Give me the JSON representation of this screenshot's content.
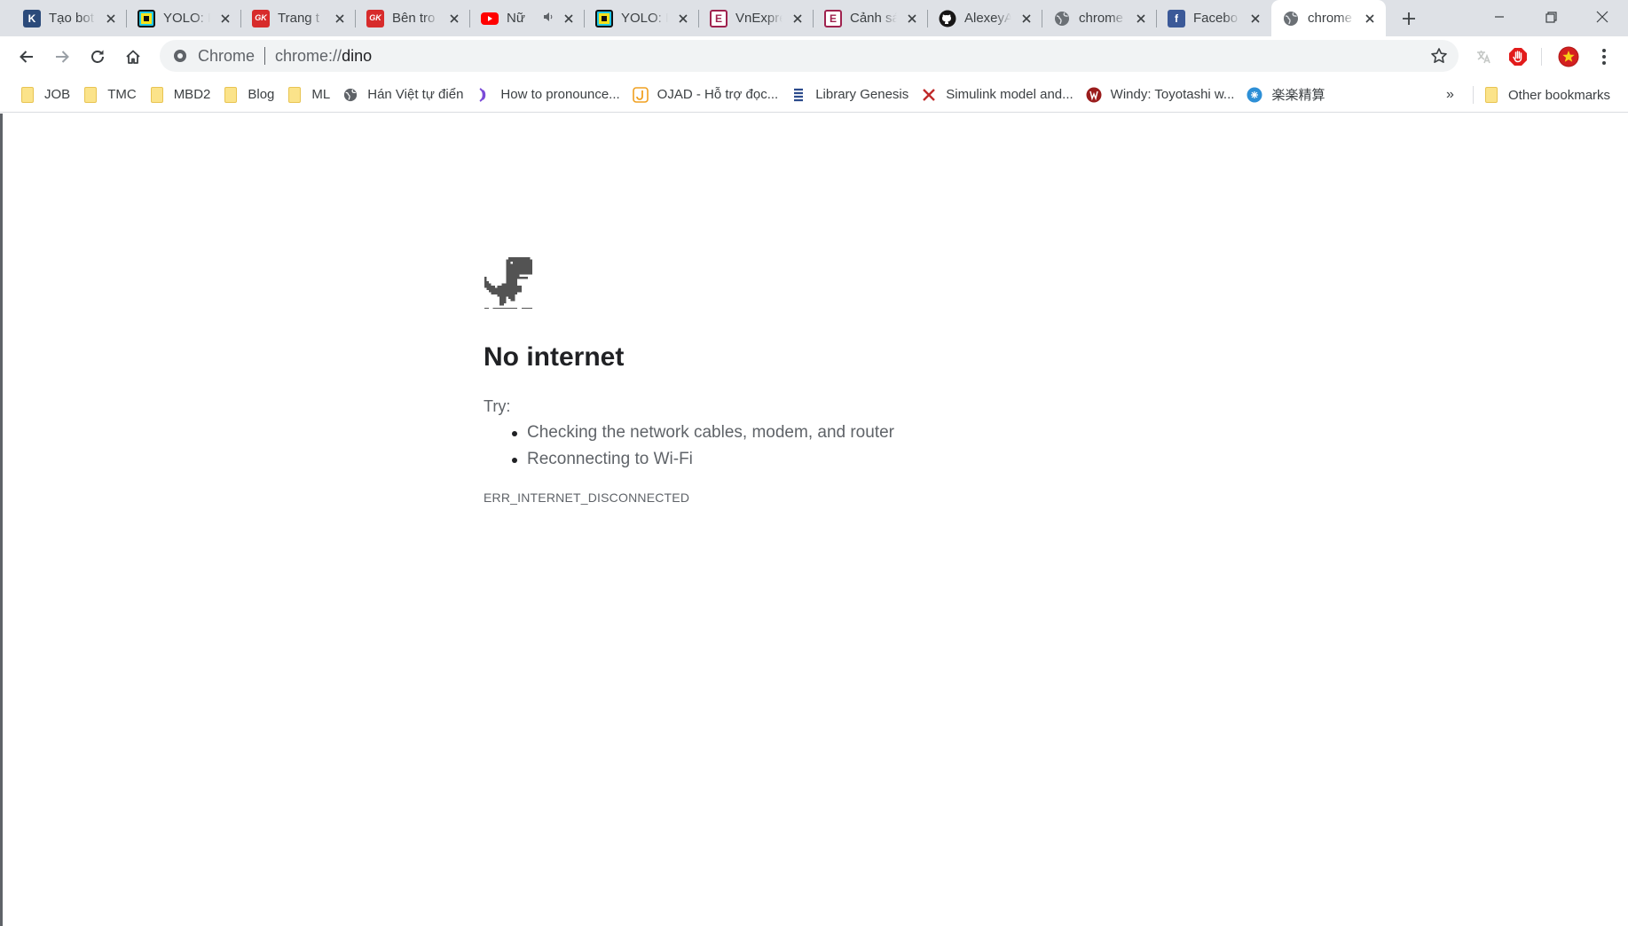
{
  "tabs": [
    {
      "favicon": "k-icon",
      "fav_text": "K",
      "title": "Tạo bot",
      "active": false
    },
    {
      "favicon": "yolo-icon",
      "fav_text": "",
      "title": "YOLO: F",
      "active": false
    },
    {
      "favicon": "news-red-icon",
      "fav_text": "GK",
      "title": "Trang t",
      "active": false
    },
    {
      "favicon": "news-red-icon",
      "fav_text": "GK",
      "title": "Bên tro",
      "active": false
    },
    {
      "favicon": "youtube-icon",
      "fav_text": "",
      "title": "Nữ",
      "active": false,
      "audio": true
    },
    {
      "favicon": "yolo-icon",
      "fav_text": "",
      "title": "YOLO: F",
      "active": false
    },
    {
      "favicon": "vnexpress-icon",
      "fav_text": "E",
      "title": "VnExpre",
      "active": false
    },
    {
      "favicon": "vnexpress-icon",
      "fav_text": "E",
      "title": "Cảnh sá",
      "active": false
    },
    {
      "favicon": "github-icon",
      "fav_text": "",
      "title": "AlexeyA",
      "active": false
    },
    {
      "favicon": "globe-icon",
      "fav_text": "",
      "title": "chrome",
      "active": false
    },
    {
      "favicon": "facebook-icon",
      "fav_text": "f",
      "title": "Facebo",
      "active": false
    },
    {
      "favicon": "globe-icon",
      "fav_text": "",
      "title": "chrome",
      "active": true
    }
  ],
  "toolbar": {
    "omnibox_chip": "Chrome",
    "url_scheme": "chrome://",
    "url_host": "dino"
  },
  "bookmarks": [
    {
      "icon": "folder-icon",
      "label": "JOB"
    },
    {
      "icon": "folder-icon",
      "label": "TMC"
    },
    {
      "icon": "folder-icon",
      "label": "MBD2"
    },
    {
      "icon": "folder-icon",
      "label": "Blog"
    },
    {
      "icon": "folder-icon",
      "label": "ML"
    },
    {
      "icon": "globe-icon",
      "label": "Hán Việt tự điển"
    },
    {
      "icon": "soundwave-icon",
      "label": "How to pronounce..."
    },
    {
      "icon": "ojad-icon",
      "label": "OJAD - Hỗ trợ đọc..."
    },
    {
      "icon": "library-icon",
      "label": "Library Genesis"
    },
    {
      "icon": "simulink-icon",
      "label": "Simulink model and..."
    },
    {
      "icon": "windy-icon",
      "label": "Windy: Toyotashi w..."
    },
    {
      "icon": "gakugaku-icon",
      "label": "楽楽精算"
    }
  ],
  "bookmarks_more": "»",
  "other_bookmarks": "Other bookmarks",
  "error_page": {
    "title": "No internet",
    "try_label": "Try:",
    "suggestions": [
      "Checking the network cables, modem, and router",
      "Reconnecting to Wi-Fi"
    ],
    "error_code": "ERR_INTERNET_DISCONNECTED"
  }
}
